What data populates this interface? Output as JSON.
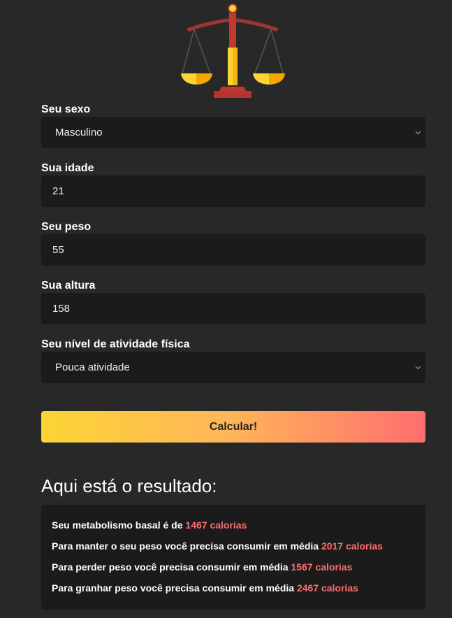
{
  "logo": {
    "icon": "balance-scale-icon",
    "colors": {
      "beam": "#9e3535",
      "pan": "#f9b60d",
      "pillar": "#fcd535"
    }
  },
  "form": {
    "sex": {
      "label": "Seu sexo",
      "value": "Masculino"
    },
    "age": {
      "label": "Sua idade",
      "value": "21"
    },
    "weight": {
      "label": "Seu peso",
      "value": "55"
    },
    "height": {
      "label": "Sua altura",
      "value": "158"
    },
    "activity": {
      "label": "Seu nível de atividade física",
      "value": "Pouca atividade"
    }
  },
  "button": {
    "label": "Calcular!"
  },
  "result": {
    "title": "Aqui está o resultado:",
    "lines": [
      {
        "text": "Seu metabolismo basal é de ",
        "value": "1467 calorias"
      },
      {
        "text": "Para manter o seu peso você precisa consumir em média ",
        "value": "2017 calorias"
      },
      {
        "text": "Para perder peso você precisa consumir em média ",
        "value": "1567 calorias"
      },
      {
        "text": "Para granhar peso você precisa consumir em média ",
        "value": "2467 calorias"
      }
    ]
  },
  "colors": {
    "background": "#282828",
    "field": "#1b1b1c",
    "highlight": "#ff6e6e"
  }
}
